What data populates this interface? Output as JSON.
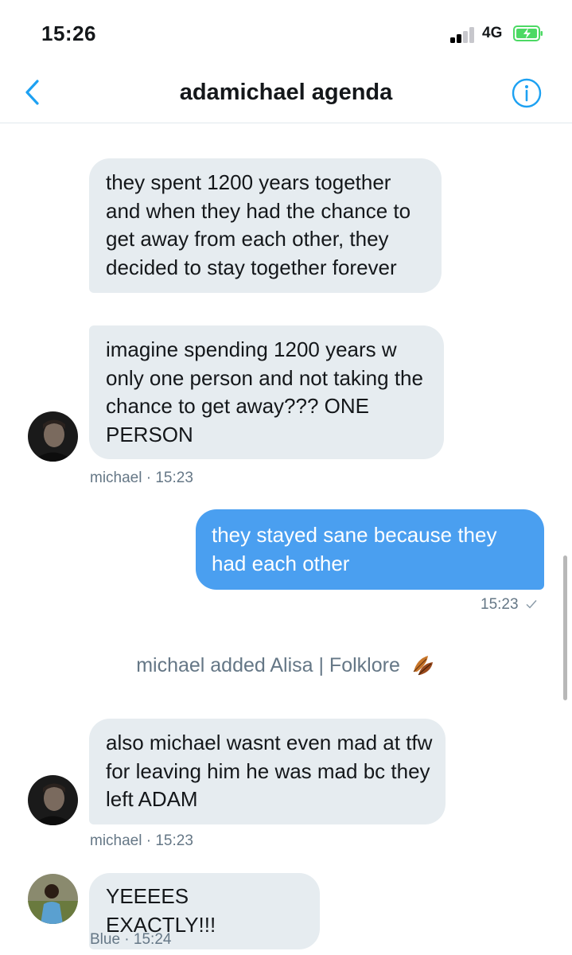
{
  "status_bar": {
    "time": "15:26",
    "network": "4G",
    "icons": [
      "signal-icon",
      "battery-charging-icon"
    ]
  },
  "header": {
    "title": "adamichael agenda",
    "back_icon": "chevron-left-icon",
    "info_icon": "info-icon"
  },
  "colors": {
    "accent": "#1da1f2",
    "outgoing_bubble": "#4a9ff0",
    "incoming_bubble": "#e6ecf0",
    "meta_text": "#657786"
  },
  "messages": [
    {
      "text": "they spent 1200 years together and when they had the chance to get away from each other, they decided to stay together forever"
    },
    {
      "text": "imagine spending 1200 years w only one person and not taking the chance to get away??? ONE PERSON"
    },
    {
      "meta": "michael · 15:23"
    },
    {
      "text": "they stayed sane because they had each other",
      "meta": "15:23",
      "status_icon": "checkmark-icon"
    },
    {
      "event": "michael added Alisa | Folklore",
      "event_icon": "fallen-leaf-emoji"
    },
    {
      "text": "also michael wasnt even mad at tfw for leaving him he was mad bc they left ADAM",
      "meta": "michael · 15:23"
    },
    {
      "text": "YEEEES EXACTLY!!!",
      "meta": "Blue · 15:24"
    }
  ]
}
